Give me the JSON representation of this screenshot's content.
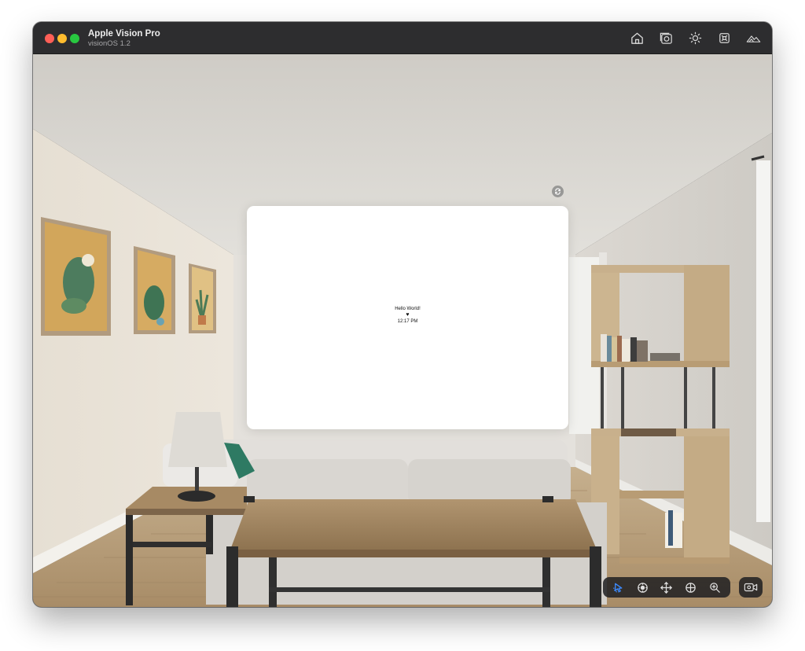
{
  "window": {
    "title": "Apple Vision Pro",
    "subtitle": "visionOS 1.2"
  },
  "toolbar": {
    "icons": [
      "home-icon",
      "screenshot-icon",
      "brightness-icon",
      "keyboard-icon",
      "environment-icon"
    ]
  },
  "app": {
    "hello_text": "Hello World!",
    "heart": "♥",
    "time": "12:17 PM"
  },
  "controls": {
    "icons": [
      "select-icon",
      "look-icon",
      "pan-icon",
      "orbit-icon",
      "zoom-icon"
    ],
    "record_icon": "record-video-icon",
    "active_color": "#3d8bff"
  }
}
